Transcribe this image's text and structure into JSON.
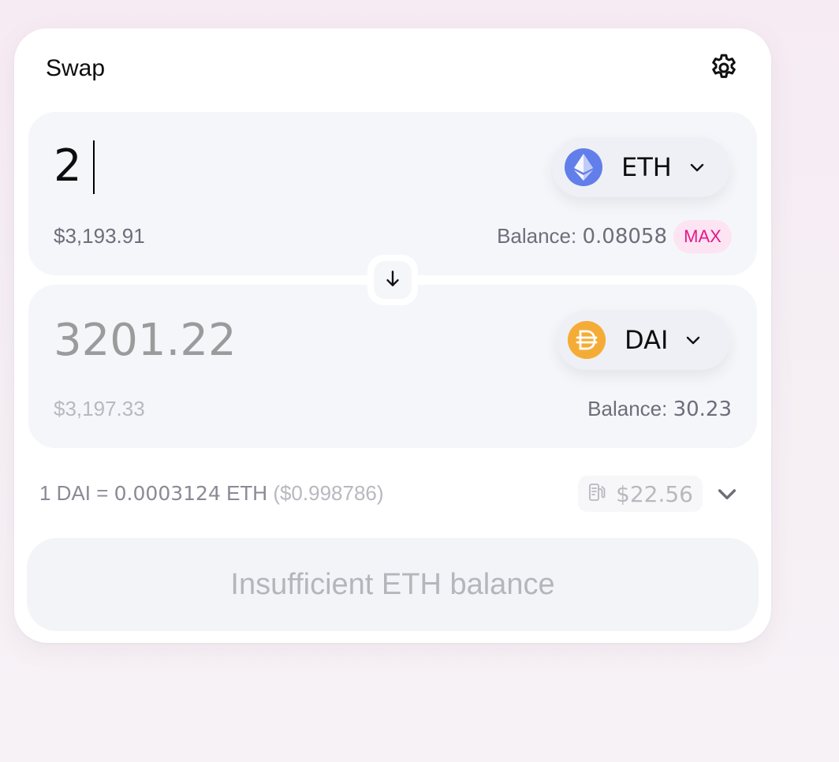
{
  "header": {
    "title": "Swap",
    "settings_icon": "gear-icon"
  },
  "sell": {
    "amount": "2",
    "token_symbol": "ETH",
    "token_icon": "ethereum-icon",
    "usd_value": "$3,193.91",
    "balance_label": "Balance: ",
    "balance_value": "0.08058",
    "max_label": "MAX"
  },
  "switch": {
    "icon": "arrow-down-icon"
  },
  "buy": {
    "amount": "3201.22",
    "token_symbol": "DAI",
    "token_icon": "dai-icon",
    "usd_value": "$3,197.33",
    "balance_label": "Balance: ",
    "balance_value": "30.23"
  },
  "rate": {
    "prefix": "1 DAI = ",
    "value": "0.0003124",
    "unit": " ETH ",
    "fiat": "($0.998786)"
  },
  "gas": {
    "icon": "gas-pump-icon",
    "value": "$22.56"
  },
  "details_toggle_icon": "chevron-down-icon",
  "cta": {
    "label": "Insufficient ETH balance"
  },
  "colors": {
    "accent_pink": "#e5178a",
    "max_bg": "#fde4f2",
    "eth_blue": "#627eea",
    "dai_orange": "#f5ac37",
    "panel_bg": "#f5f6fa"
  }
}
